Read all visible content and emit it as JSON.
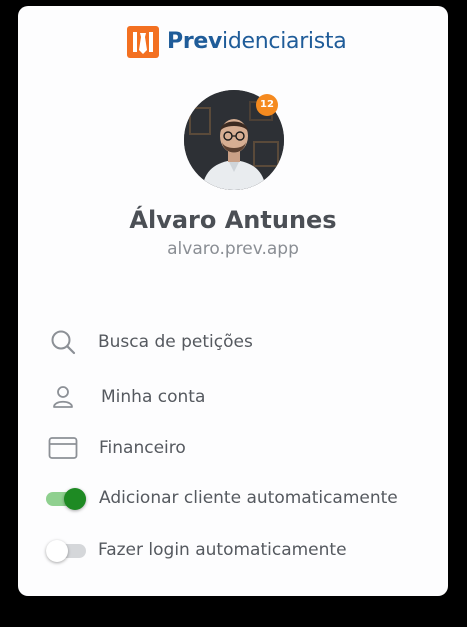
{
  "brand": {
    "name_part1": "Prev",
    "name_part2": "idenciarista",
    "colors": {
      "orange": "#f37021",
      "blue": "#1f5c99"
    }
  },
  "profile": {
    "name": "Álvaro Antunes",
    "handle": "alvaro.prev.app",
    "notification_count": "12"
  },
  "menu": [
    {
      "label": "Busca de petições",
      "icon": "search-icon"
    },
    {
      "label": "Minha conta",
      "icon": "user-icon"
    },
    {
      "label": "Financeiro",
      "icon": "credit-card-icon"
    }
  ],
  "toggles": [
    {
      "label": "Adicionar cliente automaticamente",
      "on": true
    },
    {
      "label": "Fazer login automaticamente",
      "on": false
    }
  ],
  "colors": {
    "toggle_on_knob": "#1e8a23",
    "toggle_on_track": "#8fd08f",
    "toggle_off_knob": "#ffffff",
    "toggle_off_track": "#d5d7da"
  }
}
